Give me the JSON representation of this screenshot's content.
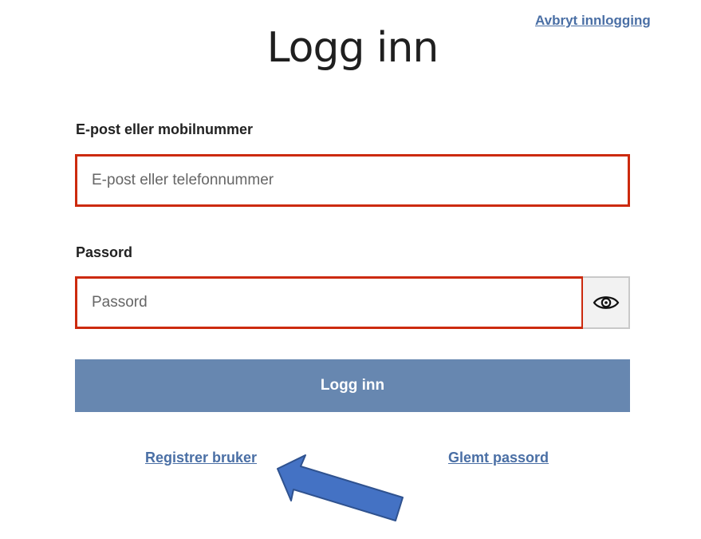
{
  "header": {
    "cancel_label": "Avbryt innlogging",
    "title": "Logg inn"
  },
  "form": {
    "email": {
      "label": "E-post eller mobilnummer",
      "placeholder": "E-post eller telefonnummer",
      "value": ""
    },
    "password": {
      "label": "Passord",
      "placeholder": "Passord",
      "value": "",
      "toggle_icon": "eye-icon"
    },
    "submit_label": "Logg inn"
  },
  "links": {
    "register_label": "Registrer bruker",
    "forgot_label": "Glemt passord"
  },
  "colors": {
    "link": "#4a6fa5",
    "error_border": "#cc2a0e",
    "button": "#6787b0",
    "annotation_arrow": "#4472c4"
  }
}
